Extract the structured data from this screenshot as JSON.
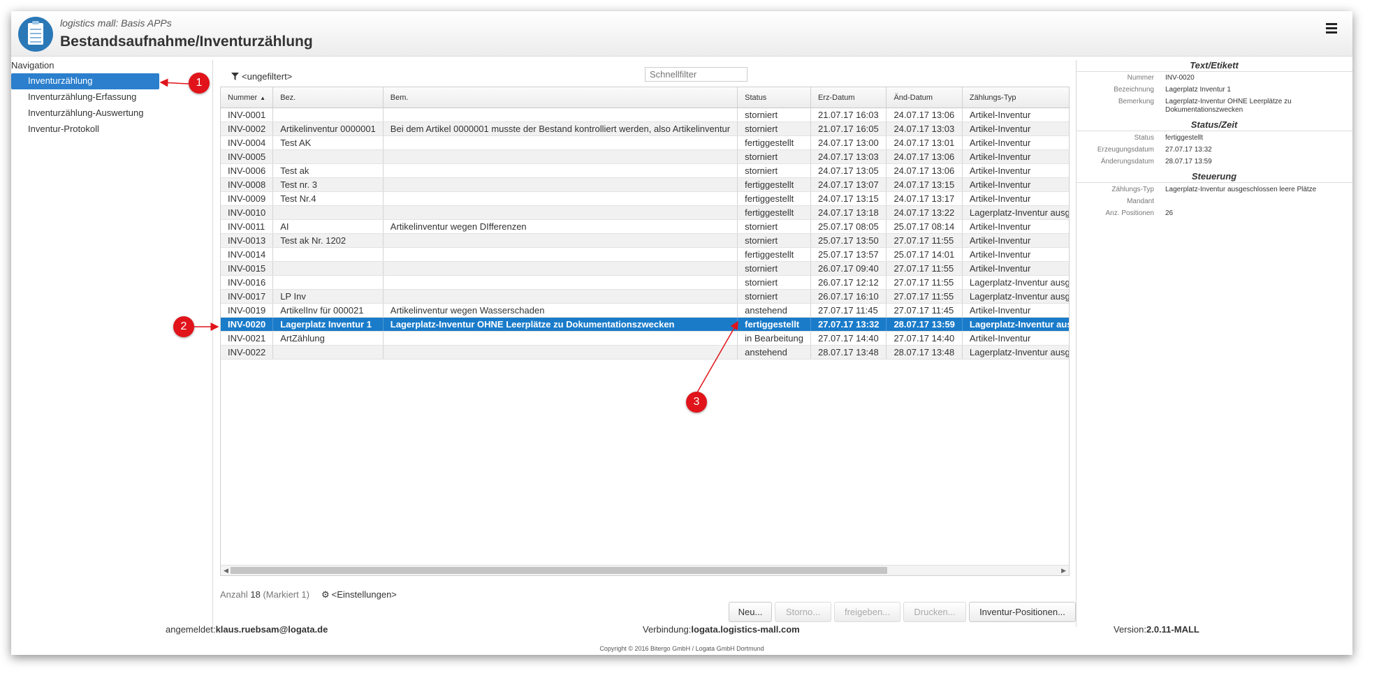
{
  "app": {
    "subtitle": "logistics mall: Basis APPs",
    "title": "Bestandsaufnahme/Inventurzählung",
    "menu_icon": "hamburger-menu-icon"
  },
  "navigation": {
    "label": "Navigation",
    "items": [
      {
        "label": "Inventurzählung",
        "active": true
      },
      {
        "label": "Inventurzählung-Erfassung",
        "active": false
      },
      {
        "label": "Inventurzählung-Auswertung",
        "active": false
      },
      {
        "label": "Inventur-Protokoll",
        "active": false
      }
    ]
  },
  "filter": {
    "label": "<ungefiltert>",
    "icon": "filter-icon",
    "quickfilter_placeholder": "Schnellfilter"
  },
  "table": {
    "columns": [
      "Nummer",
      "Bez.",
      "Bem.",
      "Status",
      "Erz-Datum",
      "Änd-Datum",
      "Zählungs-Typ"
    ],
    "sort_column": "Nummer",
    "sort_direction": "ascending",
    "selected_row": "INV-0020",
    "rows": [
      [
        "INV-0001",
        "",
        "",
        "storniert",
        "21.07.17 16:03",
        "24.07.17 13:06",
        "Artikel-Inventur"
      ],
      [
        "INV-0002",
        "Artikelinventur 0000001",
        "Bei dem Artikel 0000001 musste der Bestand kontrolliert werden, also Artikelinventur",
        "storniert",
        "21.07.17 16:05",
        "24.07.17 13:03",
        "Artikel-Inventur"
      ],
      [
        "INV-0004",
        "Test AK",
        "",
        "fertiggestellt",
        "24.07.17 13:00",
        "24.07.17 13:01",
        "Artikel-Inventur"
      ],
      [
        "INV-0005",
        "",
        "",
        "storniert",
        "24.07.17 13:03",
        "24.07.17 13:06",
        "Artikel-Inventur"
      ],
      [
        "INV-0006",
        "Test ak",
        "",
        "storniert",
        "24.07.17 13:05",
        "24.07.17 13:06",
        "Artikel-Inventur"
      ],
      [
        "INV-0008",
        "Test nr. 3",
        "",
        "fertiggestellt",
        "24.07.17 13:07",
        "24.07.17 13:15",
        "Artikel-Inventur"
      ],
      [
        "INV-0009",
        "Test Nr.4",
        "",
        "fertiggestellt",
        "24.07.17 13:15",
        "24.07.17 13:17",
        "Artikel-Inventur"
      ],
      [
        "INV-0010",
        "",
        "",
        "fertiggestellt",
        "24.07.17 13:18",
        "24.07.17 13:22",
        "Lagerplatz-Inventur ausg"
      ],
      [
        "INV-0011",
        "AI",
        "Artikelinventur wegen DIfferenzen",
        "storniert",
        "25.07.17 08:05",
        "25.07.17 08:14",
        "Artikel-Inventur"
      ],
      [
        "INV-0013",
        "Test ak Nr. 1202",
        "",
        "storniert",
        "25.07.17 13:50",
        "27.07.17 11:55",
        "Artikel-Inventur"
      ],
      [
        "INV-0014",
        "",
        "",
        "fertiggestellt",
        "25.07.17 13:57",
        "25.07.17 14:01",
        "Artikel-Inventur"
      ],
      [
        "INV-0015",
        "",
        "",
        "storniert",
        "26.07.17 09:40",
        "27.07.17 11:55",
        "Artikel-Inventur"
      ],
      [
        "INV-0016",
        "",
        "",
        "storniert",
        "26.07.17 12:12",
        "27.07.17 11:55",
        "Lagerplatz-Inventur ausg"
      ],
      [
        "INV-0017",
        "LP Inv",
        "",
        "storniert",
        "26.07.17 16:10",
        "27.07.17 11:55",
        "Lagerplatz-Inventur ausg"
      ],
      [
        "INV-0019",
        "ArtikelInv für 000021",
        "Artikelinventur wegen Wasserschaden",
        "anstehend",
        "27.07.17 11:45",
        "27.07.17 11:45",
        "Artikel-Inventur"
      ],
      [
        "INV-0020",
        "Lagerplatz Inventur 1",
        "Lagerplatz-Inventur OHNE Leerplätze zu Dokumentationszwecken",
        "fertiggestellt",
        "27.07.17 13:32",
        "28.07.17 13:59",
        "Lagerplatz-Inventur ausg"
      ],
      [
        "INV-0021",
        "ArtZählung",
        "",
        "in Bearbeitung",
        "27.07.17 14:40",
        "27.07.17 14:40",
        "Artikel-Inventur"
      ],
      [
        "INV-0022",
        "",
        "",
        "anstehend",
        "28.07.17 13:48",
        "28.07.17 13:48",
        "Lagerplatz-Inventur ausg"
      ]
    ]
  },
  "status_bar": {
    "count_label": "Anzahl",
    "count": "18",
    "marked": "(Markiert 1)",
    "settings_label": "<Einstellungen>",
    "settings_icon": "gear-icon"
  },
  "buttons": [
    {
      "label": "Neu...",
      "enabled": true
    },
    {
      "label": "Storno...",
      "enabled": false
    },
    {
      "label": "freigeben...",
      "enabled": false
    },
    {
      "label": "Drucken...",
      "enabled": false
    },
    {
      "label": "Inventur-Positionen...",
      "enabled": true
    }
  ],
  "details": {
    "sections": [
      {
        "title": "Text/Etikett",
        "rows": [
          {
            "label": "Nummer",
            "value": "INV-0020"
          },
          {
            "label": "Bezeichnung",
            "value": "Lagerplatz Inventur 1"
          },
          {
            "label": "Bemerkung",
            "value": "Lagerplatz-Inventur OHNE Leerplätze zu Dokumentationszwecken"
          }
        ]
      },
      {
        "title": "Status/Zeit",
        "rows": [
          {
            "label": "Status",
            "value": "fertiggestellt"
          },
          {
            "label": "Erzeugungsdatum",
            "value": "27.07.17 13:32"
          },
          {
            "label": "Änderungsdatum",
            "value": "28.07.17 13:59"
          }
        ]
      },
      {
        "title": "Steuerung",
        "rows": [
          {
            "label": "Zählungs-Typ",
            "value": "Lagerplatz-Inventur ausgeschlossen leere Plätze"
          },
          {
            "label": "Mandant",
            "value": ""
          },
          {
            "label": "Anz. Positionen",
            "value": "26"
          }
        ]
      }
    ]
  },
  "footer": {
    "user_label": "angemeldet:",
    "user": "klaus.ruebsam@logata.de",
    "connection_label": "Verbindung:",
    "connection": "logata.logistics-mall.com",
    "version_label": "Version:",
    "version": "2.0.11-MALL",
    "copyright": "Copyright © 2016 Bitergo GmbH / Logata GmbH Dortmund"
  },
  "callouts": [
    "1",
    "2",
    "3"
  ],
  "colors": {
    "selection": "#1a7bc9",
    "nav_active": "#2b7fcd",
    "callout": "#e0141a"
  }
}
